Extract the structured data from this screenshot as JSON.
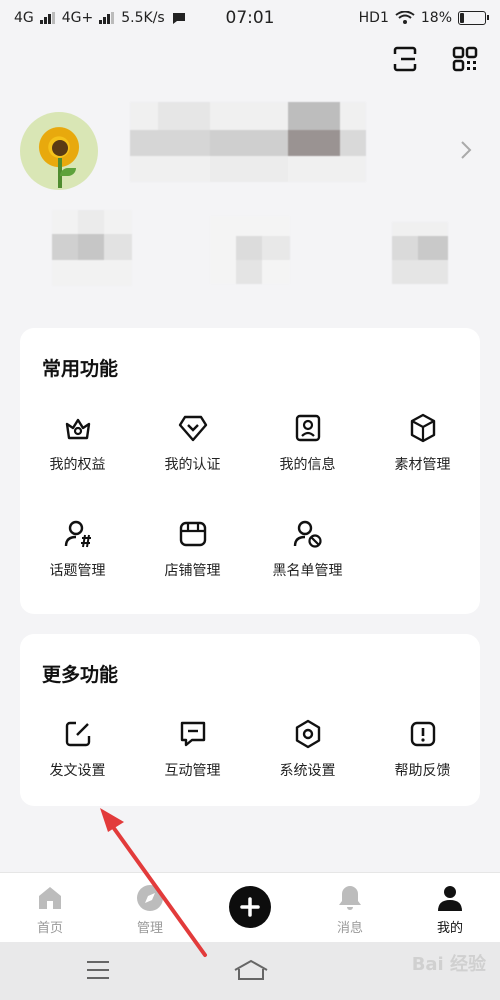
{
  "status_bar": {
    "left": [
      "4G",
      "4G+",
      "5.5K/s"
    ],
    "time": "07:01",
    "right_hd": "HD1",
    "battery": "18%",
    "battery_level": 0.18
  },
  "common_functions": {
    "title": "常用功能",
    "items": [
      {
        "label": "我的权益",
        "icon": "crown-icon"
      },
      {
        "label": "我的认证",
        "icon": "verify-badge-icon"
      },
      {
        "label": "我的信息",
        "icon": "id-card-icon"
      },
      {
        "label": "素材管理",
        "icon": "cube-icon"
      },
      {
        "label": "话题管理",
        "icon": "user-hashtag-icon"
      },
      {
        "label": "店铺管理",
        "icon": "store-icon"
      },
      {
        "label": "黑名单管理",
        "icon": "user-block-icon"
      }
    ]
  },
  "more_functions": {
    "title": "更多功能",
    "items": [
      {
        "label": "发文设置",
        "icon": "edit-icon"
      },
      {
        "label": "互动管理",
        "icon": "chat-icon"
      },
      {
        "label": "系统设置",
        "icon": "settings-hex-icon"
      },
      {
        "label": "帮助反馈",
        "icon": "feedback-icon"
      }
    ]
  },
  "bottom_nav": {
    "items": [
      {
        "label": "首页",
        "icon": "home-icon"
      },
      {
        "label": "管理",
        "icon": "compass-icon"
      },
      {
        "label": "",
        "icon": "plus-icon"
      },
      {
        "label": "消息",
        "icon": "bell-icon"
      },
      {
        "label": "我的",
        "icon": "person-icon",
        "active": true
      }
    ]
  },
  "watermark": "Bai 经验",
  "colors": {
    "accent": "#0d0d0d",
    "annotation_arrow": "#e23b3b",
    "inactive_nav": "#999999"
  }
}
